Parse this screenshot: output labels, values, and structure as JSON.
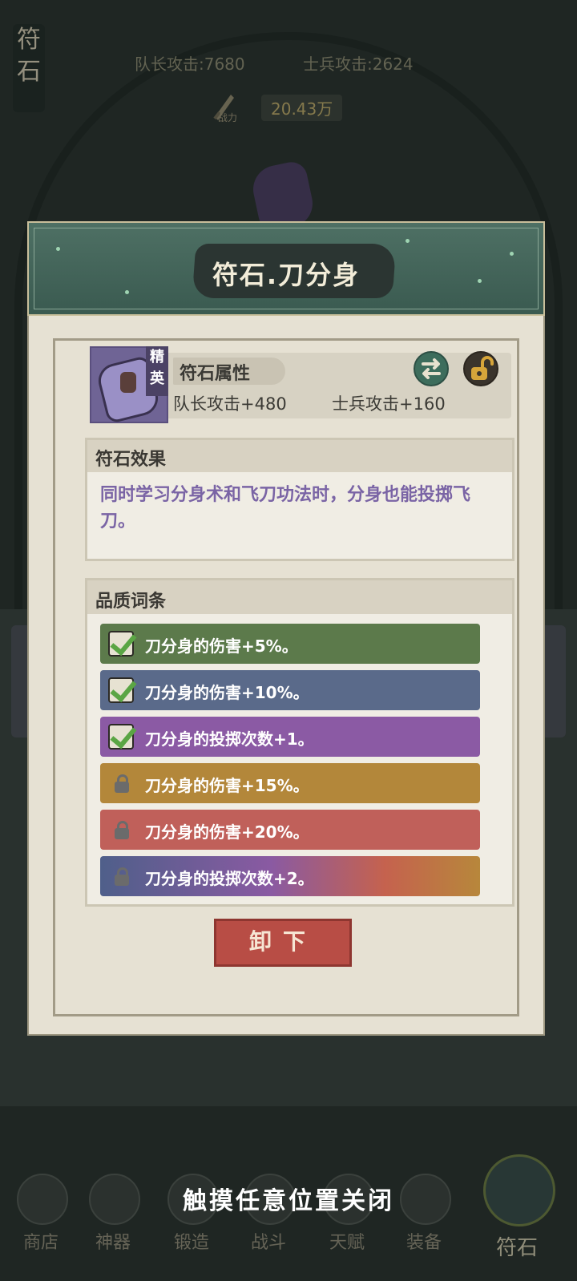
{
  "background": {
    "side_tab": "符石",
    "leader_attack": "队长攻击:7680",
    "soldier_attack": "士兵攻击:2624",
    "power_caption": "战力",
    "power_value": "20.43万"
  },
  "dialog": {
    "title": "符石.刀分身",
    "rune": {
      "rarity_badge": "精英",
      "attributes_title": "符石属性",
      "leader_attack_bonus": "队长攻击+480",
      "soldier_attack_bonus": "士兵攻击+160",
      "swap_icon": "swap-arrows-icon",
      "lock_icon": "unlocked-padlock-icon"
    },
    "effect": {
      "title": "符石效果",
      "text": "同时学习分身术和飞刀功法时，分身也能投掷飞刀。"
    },
    "quality": {
      "title": "品质词条",
      "affixes": [
        {
          "text": "刀分身的伤害+5%。",
          "unlocked": true,
          "color": "#5c7a4b"
        },
        {
          "text": "刀分身的伤害+10%。",
          "unlocked": true,
          "color": "#5a6a8a"
        },
        {
          "text": "刀分身的投掷次数+1。",
          "unlocked": true,
          "color": "#8b5aa4"
        },
        {
          "text": "刀分身的伤害+15%。",
          "unlocked": false,
          "color": "#b3873a"
        },
        {
          "text": "刀分身的伤害+20%。",
          "unlocked": false,
          "color": "#c0605a"
        },
        {
          "text": "刀分身的投掷次数+2。",
          "unlocked": false,
          "color": "gradient-blue-purple-orange"
        }
      ]
    },
    "unload_button": "卸下"
  },
  "close_hint": "触摸任意位置关闭",
  "nav": {
    "items": [
      {
        "label": "商店",
        "icon": "shop-icon"
      },
      {
        "label": "神器",
        "icon": "artifact-icon"
      },
      {
        "label": "锻造",
        "icon": "forge-icon"
      },
      {
        "label": "战斗",
        "icon": "battle-icon"
      },
      {
        "label": "天赋",
        "icon": "talent-icon"
      },
      {
        "label": "装备",
        "icon": "equipment-icon"
      },
      {
        "label": "符石",
        "icon": "rune-icon",
        "active": true
      }
    ]
  }
}
